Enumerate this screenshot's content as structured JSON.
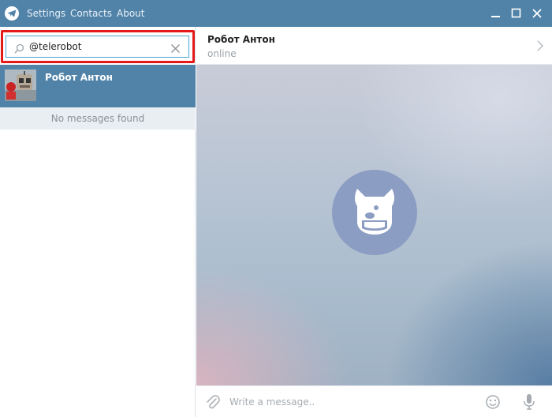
{
  "titlebar": {
    "menu": [
      "Settings",
      "Contacts",
      "About"
    ],
    "icons": [
      "telegram-logo-icon",
      "minimize-icon",
      "maximize-icon",
      "close-icon"
    ]
  },
  "search": {
    "value": "@telerobot",
    "icons": [
      "search-icon",
      "clear-icon"
    ]
  },
  "chat_list": {
    "items": [
      {
        "name": "Робот Антон"
      }
    ],
    "no_messages": "No messages found"
  },
  "chat": {
    "name": "Робот Антон",
    "status": "online",
    "placeholder": "Write a message..",
    "icons": [
      "chevron-right-icon",
      "paperclip-icon",
      "emoji-icon",
      "microphone-icon"
    ]
  },
  "colors": {
    "accent": "#5183a9",
    "highlight": "#e41a1a",
    "search_border": "#4fa3d5"
  }
}
